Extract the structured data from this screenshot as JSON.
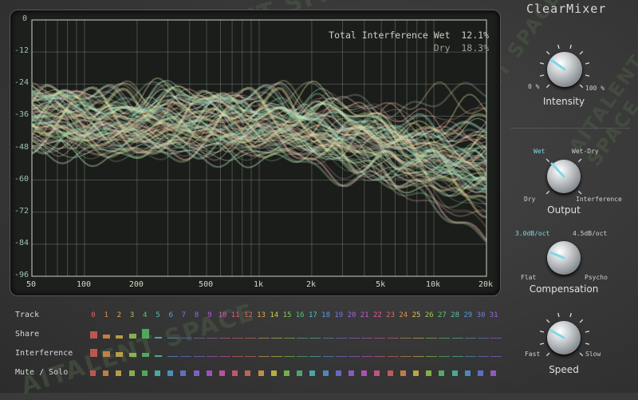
{
  "app_title": "ClearMixer",
  "watermark": "AITALENT SPACE",
  "analyzer": {
    "y_labels": [
      "0",
      "-12",
      "-24",
      "-36",
      "-48",
      "-60",
      "-72",
      "-84",
      "-96"
    ],
    "x_labels": [
      "50",
      "100",
      "200",
      "500",
      "1k",
      "2k",
      "5k",
      "10k",
      "20k"
    ],
    "total_interference_label": "Total Interference",
    "wet_label": "Wet",
    "wet_value": "12.1%",
    "dry_label": "Dry",
    "dry_value": "18.3%"
  },
  "knobs": {
    "intensity": {
      "label": "Intensity",
      "min_label": "0 %",
      "max_label": "100 %",
      "value_fraction": 0.15
    },
    "output": {
      "label": "Output",
      "top_left": "Wet",
      "top_right": "Wet-Dry",
      "bottom_left": "Dry",
      "bottom_right": "Interference",
      "selected": "Wet"
    },
    "compensation": {
      "label": "Compensation",
      "top_left": "3.0dB/oct",
      "top_right": "4.5dB/oct",
      "bottom_left": "Flat",
      "bottom_right": "Psycho",
      "selected": "3.0dB/oct"
    },
    "speed": {
      "label": "Speed",
      "left": "Fast",
      "right": "Slow",
      "value_fraction": 0.1
    }
  },
  "tracks": {
    "row_labels": {
      "track": "Track",
      "share": "Share",
      "interference": "Interference",
      "mute_solo": "Mute / Solo"
    },
    "numbers": [
      "0",
      "1",
      "2",
      "3",
      "4",
      "5",
      "6",
      "7",
      "8",
      "9",
      "10",
      "11",
      "12",
      "13",
      "14",
      "15",
      "16",
      "17",
      "18",
      "19",
      "20",
      "21",
      "22",
      "23",
      "24",
      "25",
      "26",
      "27",
      "28",
      "29",
      "30",
      "31"
    ],
    "colors": [
      "#e0605a",
      "#e0924e",
      "#d8b84a",
      "#9fcf52",
      "#57c66a",
      "#4fc7b4",
      "#4fa7d9",
      "#6b7fe0",
      "#8b6fe0",
      "#b85ad9",
      "#d957b8",
      "#e0607a",
      "#e0705a",
      "#e4a54e",
      "#cfd04a",
      "#84cc52",
      "#52c27e",
      "#52c0c6",
      "#5a9ae0",
      "#7374e0",
      "#a065e0",
      "#c95ad0",
      "#e05a9a",
      "#e06565",
      "#e0904f",
      "#d9c24b",
      "#9acc50",
      "#5ac873",
      "#50c4b0",
      "#529dde",
      "#6f7be0",
      "#a466e0"
    ],
    "share": [
      0.55,
      0.3,
      0.25,
      0.35,
      0.75,
      0.15,
      0,
      0,
      0,
      0,
      0,
      0,
      0,
      0,
      0,
      0,
      0,
      0,
      0,
      0,
      0,
      0,
      0,
      0,
      0,
      0,
      0,
      0,
      0,
      0,
      0,
      0
    ],
    "interference": [
      0.65,
      0.45,
      0.35,
      0.3,
      0.3,
      0.15,
      0,
      0,
      0,
      0,
      0,
      0,
      0,
      0,
      0,
      0,
      0,
      0,
      0,
      0,
      0,
      0,
      0,
      0,
      0,
      0,
      0,
      0,
      0,
      0,
      0,
      0
    ]
  }
}
